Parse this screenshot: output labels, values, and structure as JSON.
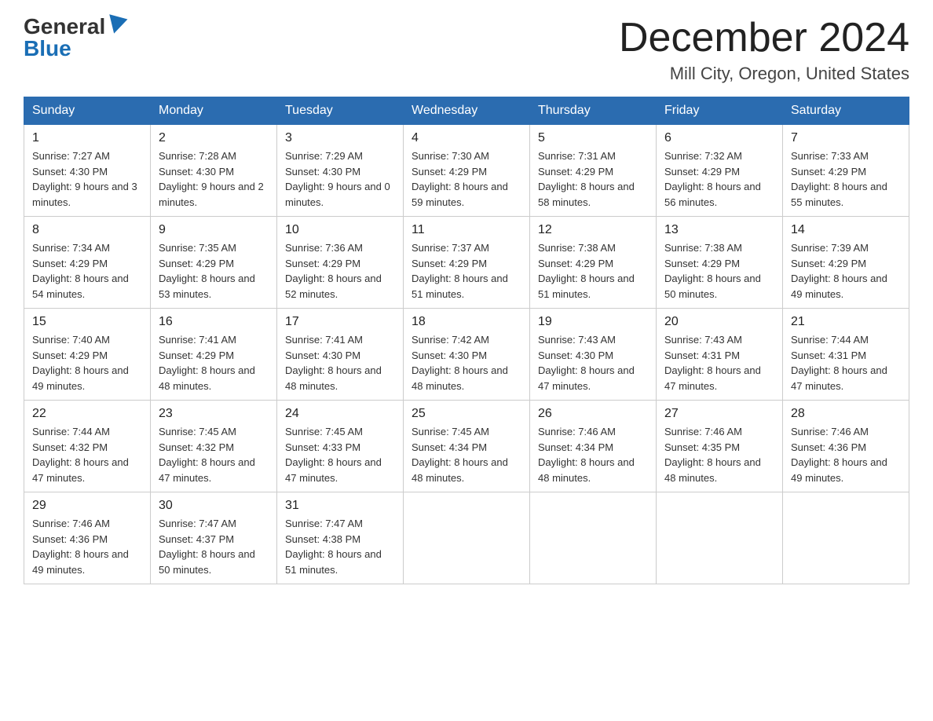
{
  "header": {
    "logo_general": "General",
    "logo_blue": "Blue",
    "month_title": "December 2024",
    "location": "Mill City, Oregon, United States"
  },
  "days_of_week": [
    "Sunday",
    "Monday",
    "Tuesday",
    "Wednesday",
    "Thursday",
    "Friday",
    "Saturday"
  ],
  "weeks": [
    [
      {
        "day": "1",
        "sunrise": "7:27 AM",
        "sunset": "4:30 PM",
        "daylight": "9 hours and 3 minutes."
      },
      {
        "day": "2",
        "sunrise": "7:28 AM",
        "sunset": "4:30 PM",
        "daylight": "9 hours and 2 minutes."
      },
      {
        "day": "3",
        "sunrise": "7:29 AM",
        "sunset": "4:30 PM",
        "daylight": "9 hours and 0 minutes."
      },
      {
        "day": "4",
        "sunrise": "7:30 AM",
        "sunset": "4:29 PM",
        "daylight": "8 hours and 59 minutes."
      },
      {
        "day": "5",
        "sunrise": "7:31 AM",
        "sunset": "4:29 PM",
        "daylight": "8 hours and 58 minutes."
      },
      {
        "day": "6",
        "sunrise": "7:32 AM",
        "sunset": "4:29 PM",
        "daylight": "8 hours and 56 minutes."
      },
      {
        "day": "7",
        "sunrise": "7:33 AM",
        "sunset": "4:29 PM",
        "daylight": "8 hours and 55 minutes."
      }
    ],
    [
      {
        "day": "8",
        "sunrise": "7:34 AM",
        "sunset": "4:29 PM",
        "daylight": "8 hours and 54 minutes."
      },
      {
        "day": "9",
        "sunrise": "7:35 AM",
        "sunset": "4:29 PM",
        "daylight": "8 hours and 53 minutes."
      },
      {
        "day": "10",
        "sunrise": "7:36 AM",
        "sunset": "4:29 PM",
        "daylight": "8 hours and 52 minutes."
      },
      {
        "day": "11",
        "sunrise": "7:37 AM",
        "sunset": "4:29 PM",
        "daylight": "8 hours and 51 minutes."
      },
      {
        "day": "12",
        "sunrise": "7:38 AM",
        "sunset": "4:29 PM",
        "daylight": "8 hours and 51 minutes."
      },
      {
        "day": "13",
        "sunrise": "7:38 AM",
        "sunset": "4:29 PM",
        "daylight": "8 hours and 50 minutes."
      },
      {
        "day": "14",
        "sunrise": "7:39 AM",
        "sunset": "4:29 PM",
        "daylight": "8 hours and 49 minutes."
      }
    ],
    [
      {
        "day": "15",
        "sunrise": "7:40 AM",
        "sunset": "4:29 PM",
        "daylight": "8 hours and 49 minutes."
      },
      {
        "day": "16",
        "sunrise": "7:41 AM",
        "sunset": "4:29 PM",
        "daylight": "8 hours and 48 minutes."
      },
      {
        "day": "17",
        "sunrise": "7:41 AM",
        "sunset": "4:30 PM",
        "daylight": "8 hours and 48 minutes."
      },
      {
        "day": "18",
        "sunrise": "7:42 AM",
        "sunset": "4:30 PM",
        "daylight": "8 hours and 48 minutes."
      },
      {
        "day": "19",
        "sunrise": "7:43 AM",
        "sunset": "4:30 PM",
        "daylight": "8 hours and 47 minutes."
      },
      {
        "day": "20",
        "sunrise": "7:43 AM",
        "sunset": "4:31 PM",
        "daylight": "8 hours and 47 minutes."
      },
      {
        "day": "21",
        "sunrise": "7:44 AM",
        "sunset": "4:31 PM",
        "daylight": "8 hours and 47 minutes."
      }
    ],
    [
      {
        "day": "22",
        "sunrise": "7:44 AM",
        "sunset": "4:32 PM",
        "daylight": "8 hours and 47 minutes."
      },
      {
        "day": "23",
        "sunrise": "7:45 AM",
        "sunset": "4:32 PM",
        "daylight": "8 hours and 47 minutes."
      },
      {
        "day": "24",
        "sunrise": "7:45 AM",
        "sunset": "4:33 PM",
        "daylight": "8 hours and 47 minutes."
      },
      {
        "day": "25",
        "sunrise": "7:45 AM",
        "sunset": "4:34 PM",
        "daylight": "8 hours and 48 minutes."
      },
      {
        "day": "26",
        "sunrise": "7:46 AM",
        "sunset": "4:34 PM",
        "daylight": "8 hours and 48 minutes."
      },
      {
        "day": "27",
        "sunrise": "7:46 AM",
        "sunset": "4:35 PM",
        "daylight": "8 hours and 48 minutes."
      },
      {
        "day": "28",
        "sunrise": "7:46 AM",
        "sunset": "4:36 PM",
        "daylight": "8 hours and 49 minutes."
      }
    ],
    [
      {
        "day": "29",
        "sunrise": "7:46 AM",
        "sunset": "4:36 PM",
        "daylight": "8 hours and 49 minutes."
      },
      {
        "day": "30",
        "sunrise": "7:47 AM",
        "sunset": "4:37 PM",
        "daylight": "8 hours and 50 minutes."
      },
      {
        "day": "31",
        "sunrise": "7:47 AM",
        "sunset": "4:38 PM",
        "daylight": "8 hours and 51 minutes."
      },
      null,
      null,
      null,
      null
    ]
  ]
}
